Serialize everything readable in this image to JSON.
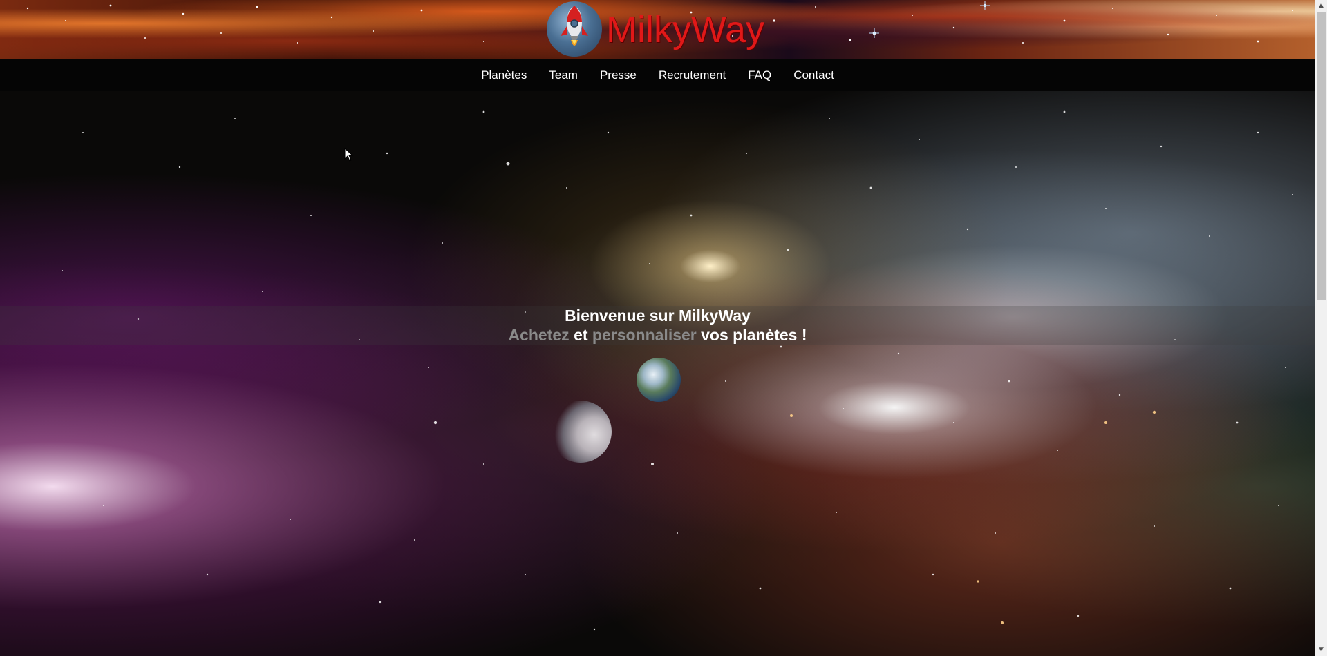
{
  "site": {
    "brand": "MilkyWay",
    "logo_icon": "rocket-icon"
  },
  "nav": {
    "items": [
      {
        "label": "Planètes"
      },
      {
        "label": "Team"
      },
      {
        "label": "Presse"
      },
      {
        "label": "Recrutement"
      },
      {
        "label": "FAQ"
      },
      {
        "label": "Contact"
      }
    ]
  },
  "hero": {
    "title": "Bienvenue sur MilkyWay",
    "subtitle": {
      "word1": "Achetez",
      "conj": "et",
      "word2": "personnaliser",
      "rest": "vos planètes !"
    }
  },
  "colors": {
    "brand_red": "#e01818",
    "nav_bg": "#050505",
    "text_white": "#ffffff",
    "text_dim": "#8a8a8a"
  },
  "scrollbar": {
    "up_icon": "scroll-up-arrow-icon",
    "down_icon": "scroll-down-arrow-icon"
  }
}
